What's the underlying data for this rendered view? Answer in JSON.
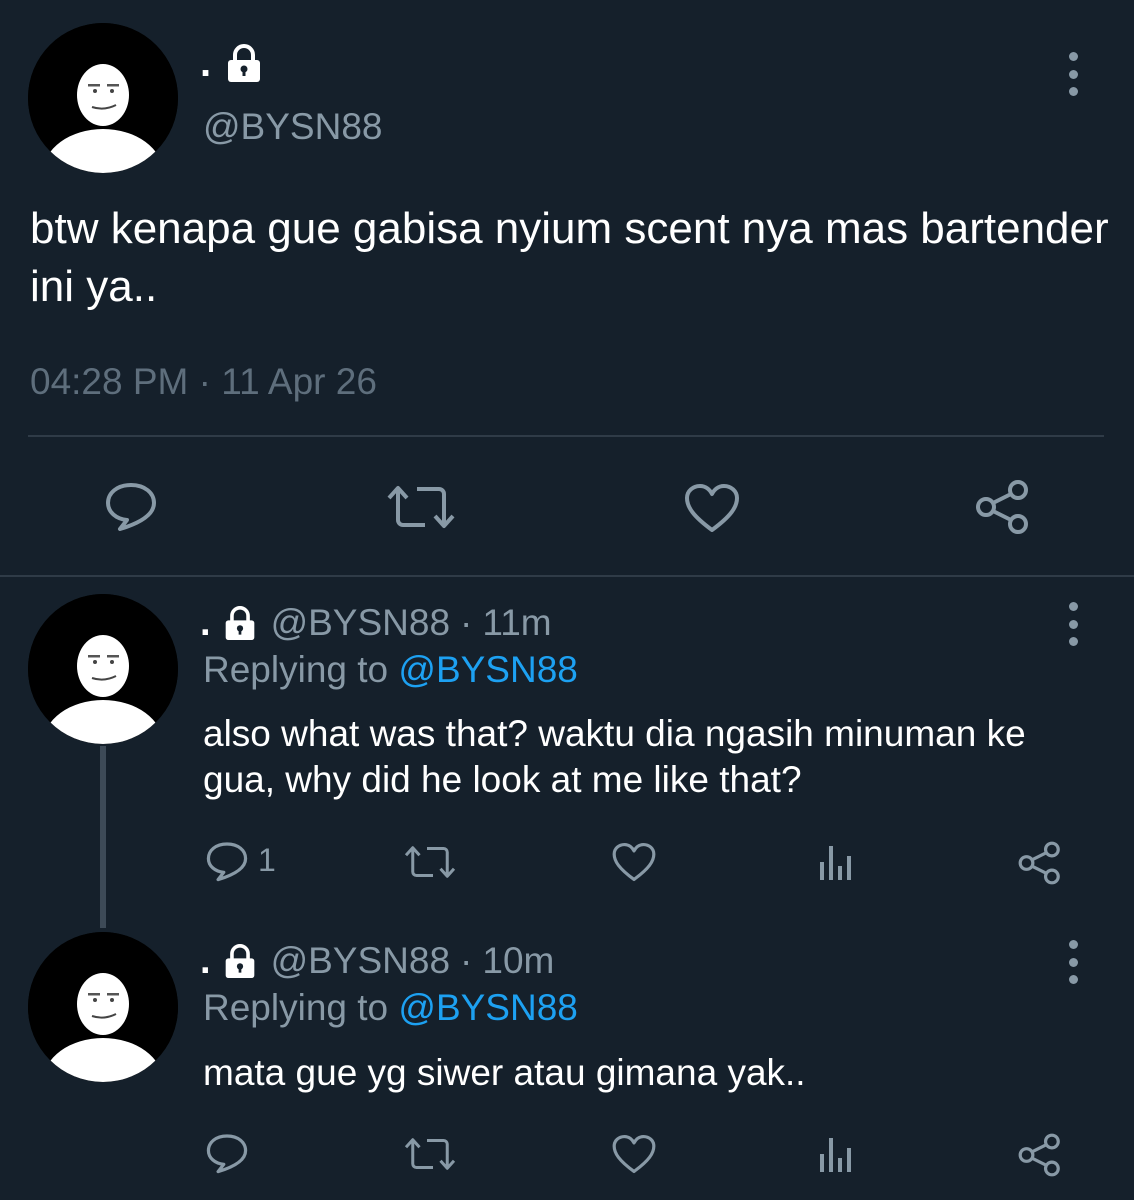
{
  "tweet": {
    "name": ".",
    "handle": "@BYSN88",
    "text": "btw kenapa gue gabisa nyium scent nya mas bartender ini ya..",
    "timestamp": "04:28 PM · 11 Apr 26",
    "icons": [
      "more-vertical-icon",
      "lock-icon",
      "reply-icon",
      "retweet-icon",
      "like-icon",
      "share-icon"
    ]
  },
  "replies": [
    {
      "name": ".",
      "handle": "@BYSN88",
      "separator": "·",
      "time": "11m",
      "replying_label": "Replying to",
      "replying_to": "@BYSN88",
      "text": "also what was that? waktu dia ngasih minuman ke gua, why did he look at me like that?",
      "reply_count": "1"
    },
    {
      "name": ".",
      "handle": "@BYSN88",
      "separator": "·",
      "time": "10m",
      "replying_label": "Replying to",
      "replying_to": "@BYSN88",
      "text": "mata gue yg siwer atau gimana yak.."
    }
  ],
  "colors": {
    "background": "#15202b",
    "secondary_text": "#8899a6",
    "link": "#1da1f2",
    "divider": "#2f3b47"
  }
}
